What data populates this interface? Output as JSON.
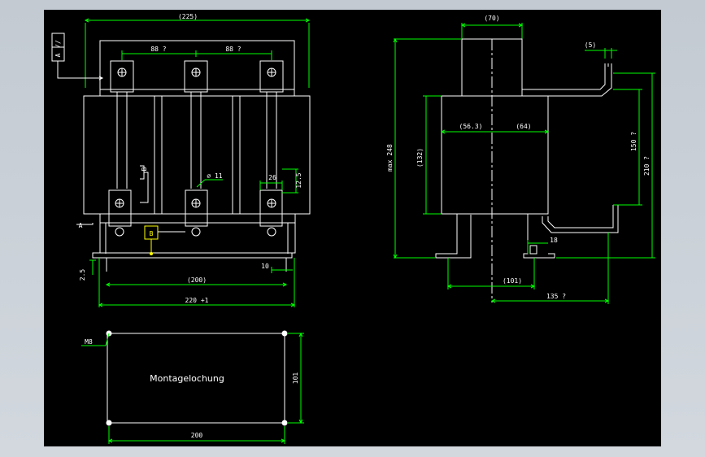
{
  "colors": {
    "background": "#000000",
    "outline": "#ffffff",
    "dimension": "#00ff00",
    "annotation": "#ffff00",
    "hidden": "#ff0000"
  },
  "front_view": {
    "overall_width": "(225)",
    "pitch_left": "88 ?",
    "pitch_right": "88 ?",
    "mount_spacing": "(200)",
    "total_width": "220 +1",
    "foot_offset": "10",
    "foot_height": "2.5",
    "hole_diameter": "⌀ 11",
    "terminal_width": "26",
    "terminal_height": "12.5",
    "label_a": "A",
    "label_b": "B",
    "gdt_symbol": "//",
    "gdt_datum": "A",
    "side_label": "B"
  },
  "side_view": {
    "top_width": "(70)",
    "max_height": "max 248",
    "body_height": "(132)",
    "left_dim": "(56.3)",
    "right_dim": "(64)",
    "bar_height": "150 ?",
    "total_height": "210 ?",
    "stud_offset": "(5)",
    "foot_depth": "(101)",
    "slot_width": "18",
    "overall_depth": "135 ?"
  },
  "mounting_plan": {
    "title": "Montagelochung",
    "hole_size": "M8",
    "height": "101",
    "width": "200"
  }
}
